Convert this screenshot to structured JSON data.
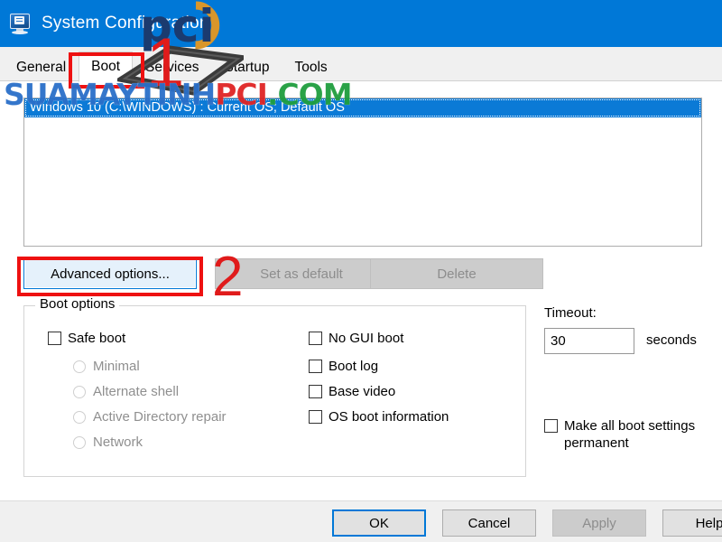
{
  "window": {
    "title": "System Configuration",
    "icon": "computer-monitor-icon"
  },
  "tabs": [
    {
      "label": "General",
      "selected": false
    },
    {
      "label": "Boot",
      "selected": true
    },
    {
      "label": "Services",
      "selected": false
    },
    {
      "label": "Startup",
      "selected": false
    },
    {
      "label": "Tools",
      "selected": false
    }
  ],
  "os_list": {
    "items": [
      {
        "text": "Windows 10 (C:\\WINDOWS) : Current OS; Default OS",
        "selected": true
      }
    ]
  },
  "list_buttons": {
    "advanced": {
      "label": "Advanced options...",
      "enabled": true,
      "focused": true
    },
    "set_default": {
      "label": "Set as default",
      "enabled": false
    },
    "delete": {
      "label": "Delete",
      "enabled": false
    }
  },
  "boot_options": {
    "group_title": "Boot options",
    "safe_boot": {
      "label": "Safe boot",
      "checked": false,
      "enabled": true
    },
    "safe_boot_modes": [
      {
        "label": "Minimal",
        "selected": false,
        "enabled": false
      },
      {
        "label": "Alternate shell",
        "selected": false,
        "enabled": false
      },
      {
        "label": "Active Directory repair",
        "selected": false,
        "enabled": false
      },
      {
        "label": "Network",
        "selected": false,
        "enabled": false
      }
    ],
    "flags": [
      {
        "label": "No GUI boot",
        "checked": false
      },
      {
        "label": "Boot log",
        "checked": false
      },
      {
        "label": "Base video",
        "checked": false
      },
      {
        "label": "OS boot information",
        "checked": false
      }
    ]
  },
  "timeout": {
    "label": "Timeout:",
    "value": "30",
    "units": "seconds"
  },
  "permanent": {
    "label": "Make all boot settings permanent",
    "checked": false
  },
  "dialog_buttons": {
    "ok": {
      "label": "OK",
      "enabled": true,
      "default": true
    },
    "cancel": {
      "label": "Cancel",
      "enabled": true
    },
    "apply": {
      "label": "Apply",
      "enabled": false
    },
    "help": {
      "label": "Help",
      "enabled": true
    }
  },
  "annotations": {
    "step_one": "1",
    "step_two": "2",
    "highlight_color": "#ee1111",
    "number_color": "#e01b1b"
  },
  "watermark": {
    "part_blue": "SUAMAYTINH",
    "part_red": "PCI",
    "part_green": ".COM",
    "logo_text": "pci",
    "color_blue": "#2a6fc9",
    "color_red": "#e02424",
    "color_green": "#1f9e3e",
    "logo_navy": "#1b3b6f",
    "logo_gold": "#d9962a"
  },
  "theme": {
    "titlebar_blue": "#0078d7",
    "selection_blue": "#0b7ad6",
    "panel_bg": "#ffffff",
    "chrome_bg": "#f0f0f0"
  }
}
